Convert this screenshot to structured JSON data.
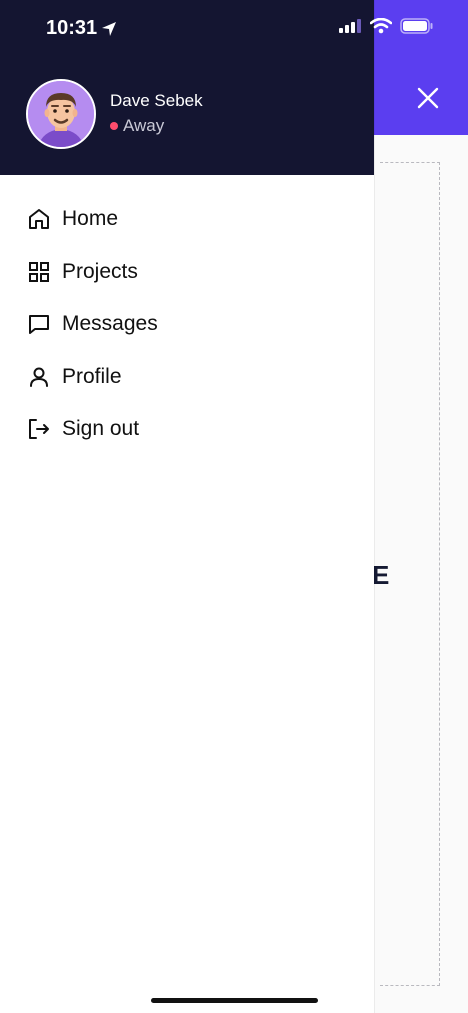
{
  "status_bar": {
    "time": "10:31",
    "icons": [
      "location-arrow-icon",
      "signal-icon",
      "wifi-icon",
      "battery-icon"
    ]
  },
  "underlay": {
    "header_color": "#5b3ef0",
    "close_icon": "close-icon",
    "partial_text": "E"
  },
  "drawer": {
    "header_color": "#141531",
    "user": {
      "name": "Dave Sebek",
      "status": "Away",
      "status_color": "#ff4d6d"
    },
    "menu": [
      {
        "label": "Home",
        "icon": "home-icon"
      },
      {
        "label": "Projects",
        "icon": "grid-icon"
      },
      {
        "label": "Messages",
        "icon": "message-icon"
      },
      {
        "label": "Profile",
        "icon": "user-icon"
      },
      {
        "label": "Sign out",
        "icon": "sign-out-icon"
      }
    ]
  }
}
